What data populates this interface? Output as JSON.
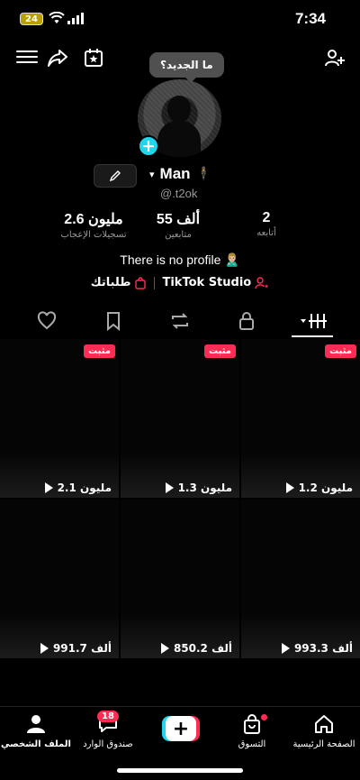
{
  "status_bar": {
    "battery": "24",
    "time": "7:34"
  },
  "tooltip": "ما الجديد؟",
  "profile": {
    "name": "Man",
    "name_emoji": "🕴",
    "handle": "@.t2ok",
    "bio": "There is no profile 🙎🏼‍♂️"
  },
  "stats": [
    {
      "value": "2",
      "label": "أتابعه"
    },
    {
      "value": "55 ألف",
      "label": "متابعين"
    },
    {
      "value": "2.6 مليون",
      "label": "تسجيلات الإعجاب"
    }
  ],
  "links": {
    "studio": "TikTok Studio",
    "orders": "طلباتك"
  },
  "pinned_label": "مثبت",
  "videos": [
    {
      "views": "1.2 مليون",
      "pinned": true
    },
    {
      "views": "1.3 مليون",
      "pinned": true
    },
    {
      "views": "2.1 مليون",
      "pinned": true
    },
    {
      "views": "993.3 ألف",
      "pinned": false
    },
    {
      "views": "850.2 ألف",
      "pinned": false
    },
    {
      "views": "991.7 ألف",
      "pinned": false
    }
  ],
  "nav": {
    "home": "الصفحة الرئيسية",
    "shop": "التسوق",
    "inbox": "صندوق الوارد",
    "inbox_badge": "18",
    "profile": "الملف الشخصي"
  },
  "colors": {
    "accent": "#fe2c55",
    "cyan": "#20d5ec",
    "background": "#000000"
  }
}
